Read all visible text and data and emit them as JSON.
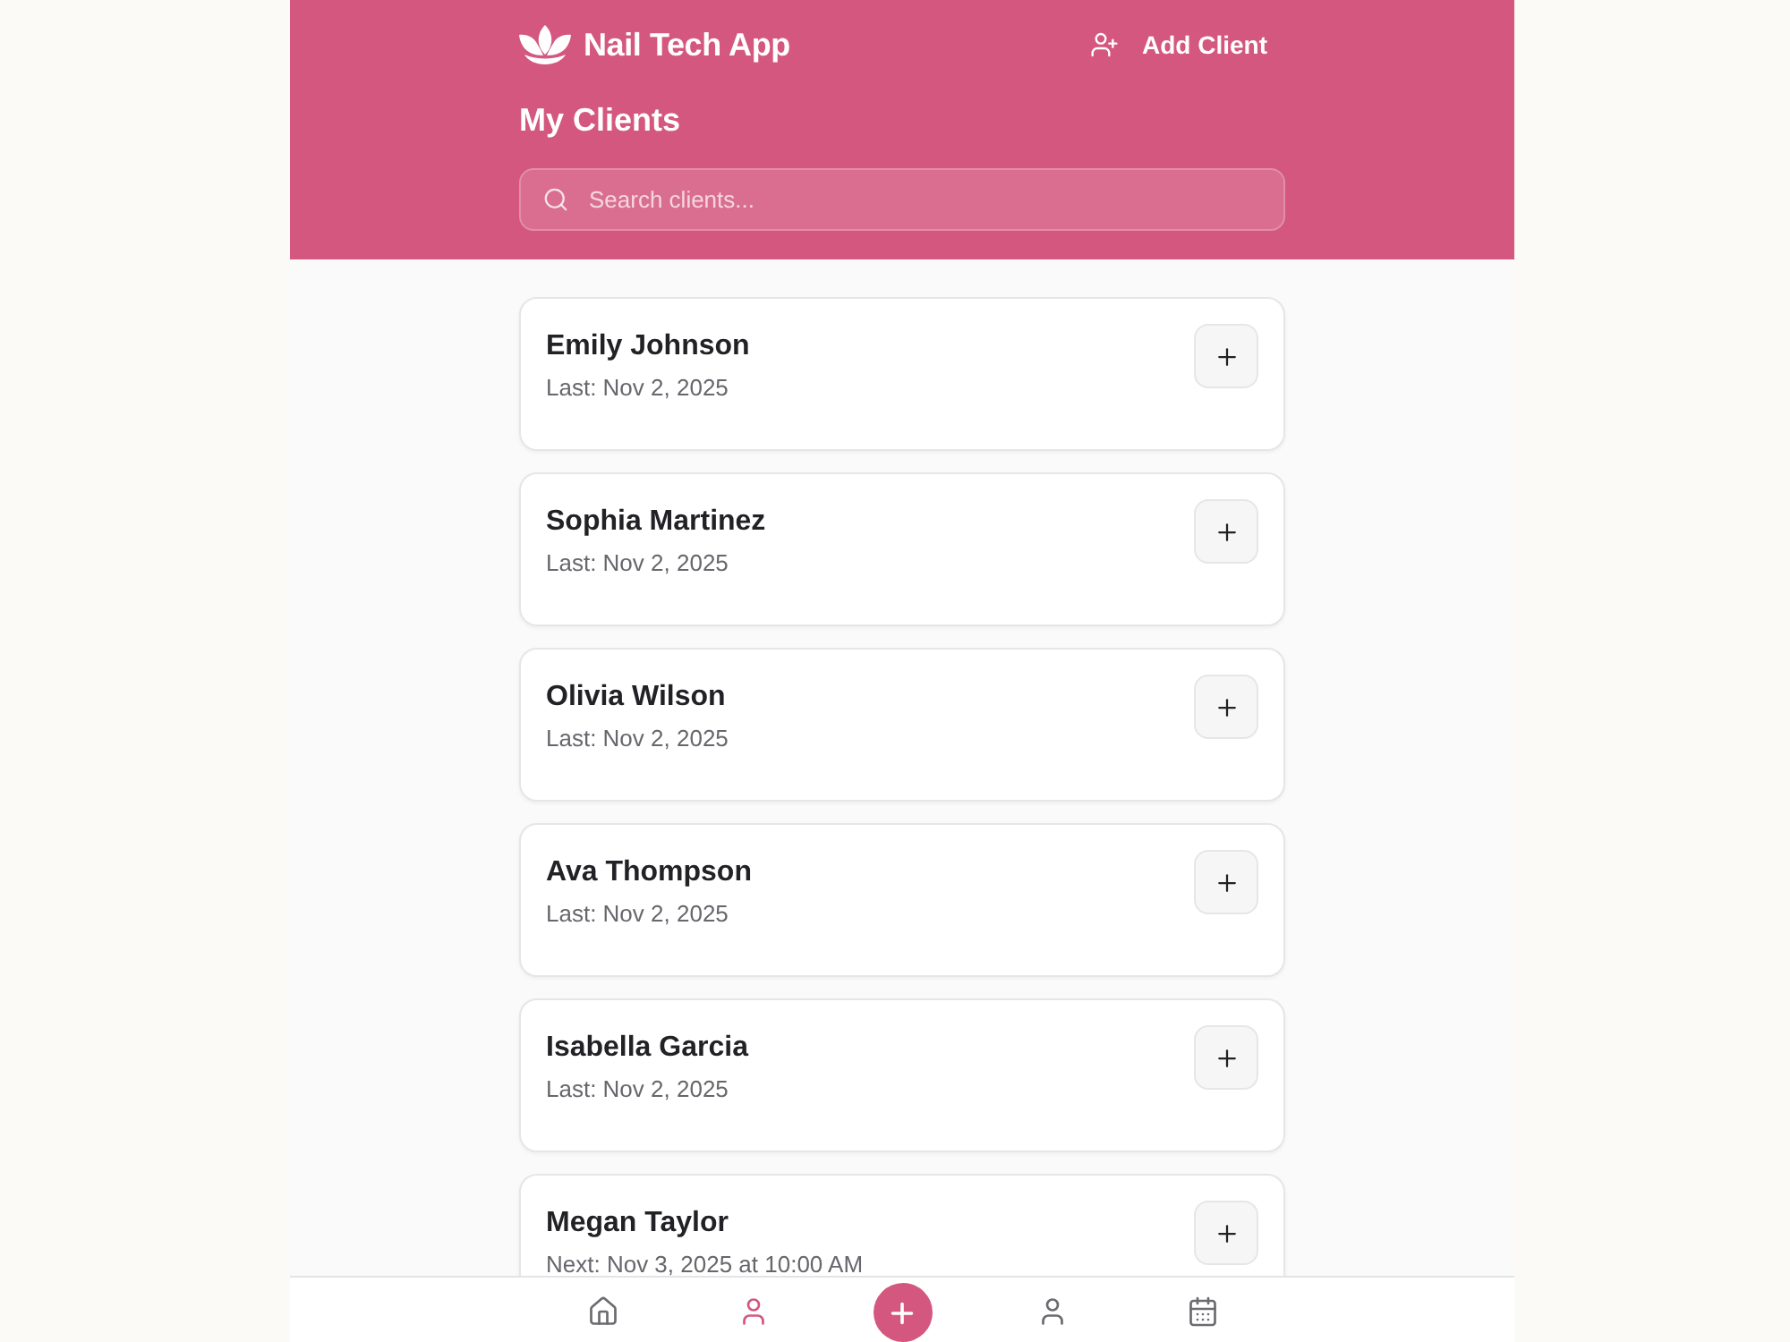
{
  "header": {
    "app_name": "Nail Tech App",
    "add_button": "Add Client",
    "title": "My Clients",
    "search": {
      "placeholder": "Search clients..."
    }
  },
  "clients": [
    {
      "name": "Emily Johnson",
      "visit": "Last: Nov 2, 2025"
    },
    {
      "name": "Sophia Martinez",
      "visit": "Last: Nov 2, 2025"
    },
    {
      "name": "Olivia Wilson",
      "visit": "Last: Nov 2, 2025"
    },
    {
      "name": "Ava Thompson",
      "visit": "Last: Nov 2, 2025"
    },
    {
      "name": "Isabella Garcia",
      "visit": "Last: Nov 2, 2025"
    },
    {
      "name": "Megan Taylor",
      "visit": "Next: Nov 3, 2025 at 10:00 AM"
    }
  ],
  "nav": {
    "items": [
      {
        "kind": "tab",
        "selected": false
      },
      {
        "kind": "tab",
        "selected": true
      },
      {
        "kind": "action",
        "selected": false
      },
      {
        "kind": "tab",
        "selected": false
      },
      {
        "kind": "tab",
        "selected": false
      }
    ]
  }
}
